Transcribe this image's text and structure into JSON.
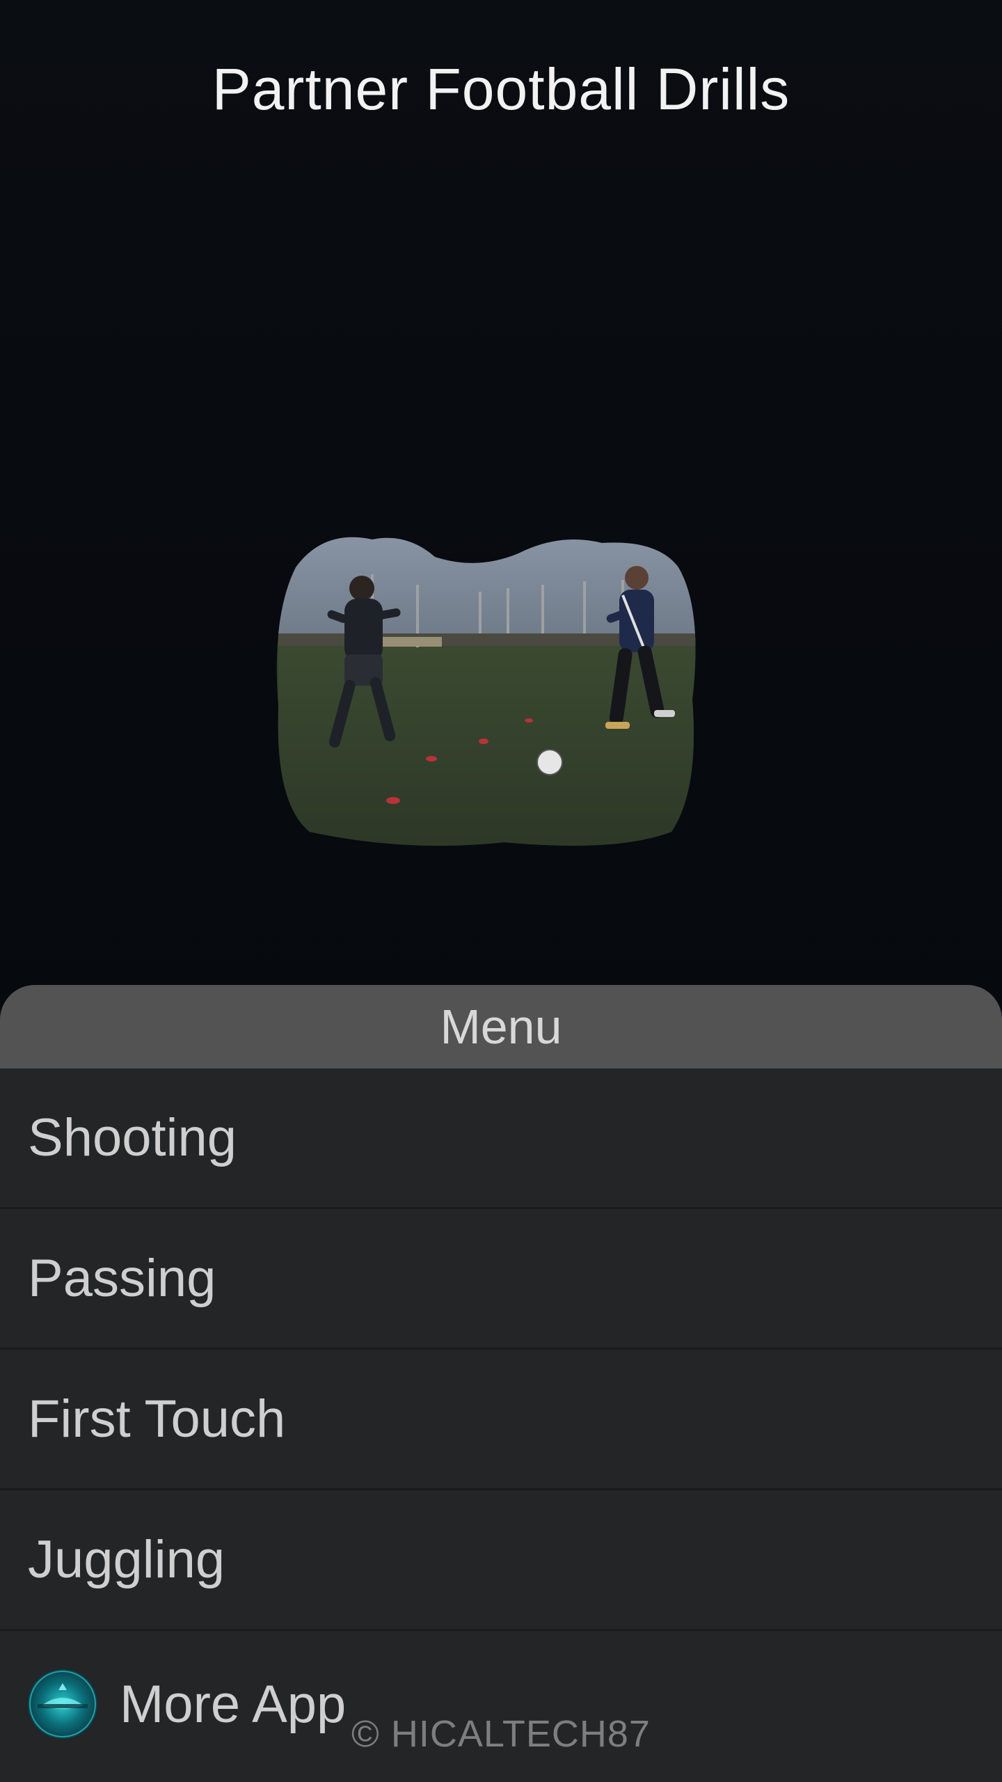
{
  "app": {
    "title": "Partner Football Drills"
  },
  "menu": {
    "header": "Menu",
    "items": [
      {
        "label": "Shooting"
      },
      {
        "label": "Passing"
      },
      {
        "label": "First Touch"
      },
      {
        "label": "Juggling"
      },
      {
        "label": "More App",
        "icon": "app-logo-icon"
      }
    ]
  },
  "watermark": "© HICALTECH87",
  "colors": {
    "background": "#070a0f",
    "menu_header_bg": "#535353",
    "menu_bg": "#242527",
    "title_text": "#f2f2f2",
    "menu_text": "#cfcfcf"
  }
}
